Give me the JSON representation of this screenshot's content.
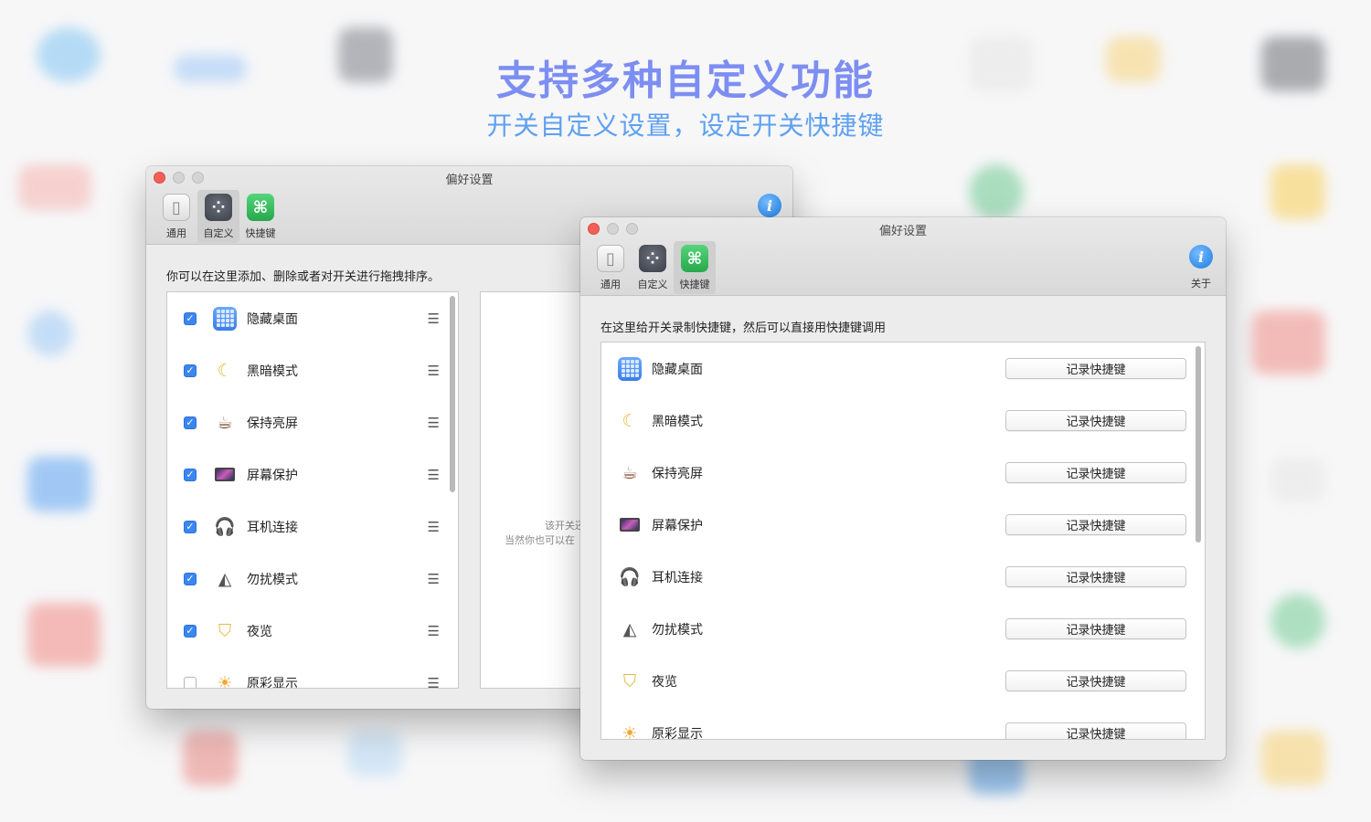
{
  "headline": "支持多种自定义功能",
  "subheadline": "开关自定义设置，设定开关快捷键",
  "colors": {
    "headline": "#7d8ef2",
    "subheadline": "#5fa0f0",
    "checkbox": "#3b86f0",
    "close": "#f25f57"
  },
  "window_back": {
    "title": "偏好设置",
    "toolbar": [
      {
        "label": "通用",
        "icon": "toggle-switch-icon"
      },
      {
        "label": "自定义",
        "icon": "dots-wheel-icon"
      },
      {
        "label": "快捷键",
        "icon": "command-key-icon"
      }
    ],
    "active_tab": "自定义",
    "hint": "你可以在这里添加、删除或者对开关进行拖拽排序。",
    "items": [
      {
        "label": "隐藏桌面",
        "checked": true,
        "icon": "grid-icon"
      },
      {
        "label": "黑暗模式",
        "checked": true,
        "icon": "moon-icon"
      },
      {
        "label": "保持亮屏",
        "checked": true,
        "icon": "coffee-cup-icon"
      },
      {
        "label": "屏幕保护",
        "checked": true,
        "icon": "monitor-icon"
      },
      {
        "label": "耳机连接",
        "checked": true,
        "icon": "headphones-icon"
      },
      {
        "label": "勿扰模式",
        "checked": true,
        "icon": "metronome-icon"
      },
      {
        "label": "夜览",
        "checked": true,
        "icon": "lamp-icon"
      },
      {
        "label": "原彩显示",
        "checked": false,
        "icon": "sun-icon"
      }
    ],
    "detail_line1": "该开关还",
    "detail_line2": "当然你也可以在"
  },
  "window_front": {
    "title": "偏好设置",
    "toolbar": [
      {
        "label": "通用",
        "icon": "toggle-switch-icon"
      },
      {
        "label": "自定义",
        "icon": "dots-wheel-icon"
      },
      {
        "label": "快捷键",
        "icon": "command-key-icon"
      }
    ],
    "active_tab": "快捷键",
    "about_label": "关于",
    "hint": "在这里给开关录制快捷键，然后可以直接用快捷键调用",
    "record_label": "记录快捷键",
    "items": [
      {
        "label": "隐藏桌面",
        "icon": "grid-icon"
      },
      {
        "label": "黑暗模式",
        "icon": "moon-icon"
      },
      {
        "label": "保持亮屏",
        "icon": "coffee-cup-icon"
      },
      {
        "label": "屏幕保护",
        "icon": "monitor-icon"
      },
      {
        "label": "耳机连接",
        "icon": "headphones-icon"
      },
      {
        "label": "勿扰模式",
        "icon": "metronome-icon"
      },
      {
        "label": "夜览",
        "icon": "lamp-icon"
      },
      {
        "label": "原彩显示",
        "icon": "sun-icon"
      }
    ]
  }
}
